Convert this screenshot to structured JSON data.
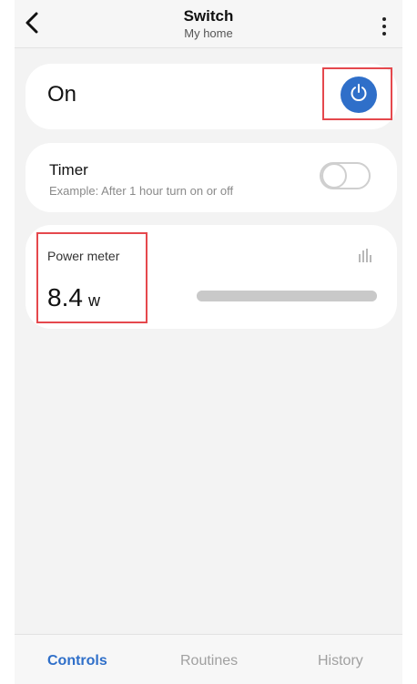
{
  "header": {
    "title": "Switch",
    "subtitle": "My home",
    "back_icon": "chevron-left-icon",
    "more_icon": "more-vertical-icon"
  },
  "power_card": {
    "state_label": "On",
    "power_icon": "power-icon",
    "button_color": "#2f6fc9",
    "highlight_color": "#e5484d"
  },
  "timer_card": {
    "title": "Timer",
    "description": "Example: After 1 hour turn on or off",
    "toggle_on": false
  },
  "power_meter": {
    "label": "Power meter",
    "value": "8.4",
    "unit": "w",
    "chart_icon": "bar-chart-icon",
    "highlight_color": "#e5484d"
  },
  "tabs": [
    {
      "label": "Controls",
      "active": true
    },
    {
      "label": "Routines",
      "active": false
    },
    {
      "label": "History",
      "active": false
    }
  ],
  "colors": {
    "accent": "#2f6fc9",
    "background": "#f3f3f3",
    "card": "#ffffff",
    "highlight": "#e5484d"
  }
}
